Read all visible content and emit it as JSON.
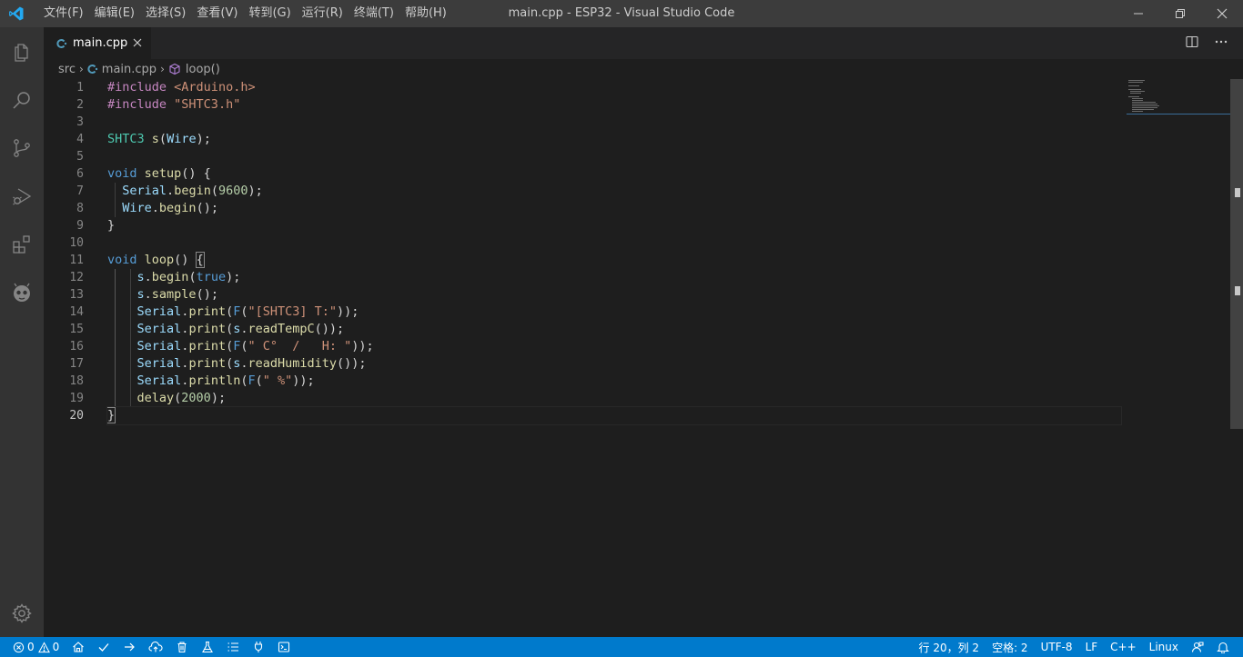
{
  "titlebar": {
    "menu": [
      "文件(F)",
      "编辑(E)",
      "选择(S)",
      "查看(V)",
      "转到(G)",
      "运行(R)",
      "终端(T)",
      "帮助(H)"
    ],
    "window_title": "main.cpp - ESP32 - Visual Studio Code"
  },
  "activitybar": {
    "icons": [
      "explorer-icon",
      "search-icon",
      "source-control-icon",
      "run-debug-icon",
      "extensions-icon",
      "platformio-icon",
      "settings-gear-icon"
    ]
  },
  "tab": {
    "label": "main.cpp"
  },
  "breadcrumb": {
    "folder": "src",
    "file": "main.cpp",
    "symbol": "loop()"
  },
  "editor": {
    "line_numbers": [
      "1",
      "2",
      "3",
      "4",
      "5",
      "6",
      "7",
      "8",
      "9",
      "10",
      "11",
      "12",
      "13",
      "14",
      "15",
      "16",
      "17",
      "18",
      "19",
      "20"
    ]
  },
  "statusbar": {
    "errors": "0",
    "warnings": "0",
    "position": "行 20，列 2",
    "spaces": "空格: 2",
    "encoding": "UTF-8",
    "eol": "LF",
    "language": "C++",
    "platform": "Linux"
  },
  "colors": {
    "titlebar": "#3c3c3c",
    "activitybar": "#333333",
    "editor_bg": "#1e1e1e",
    "statusbar": "#007acc",
    "keyword": "#569cd6",
    "string": "#ce9178",
    "type": "#4ec9b0",
    "function": "#dcdcaa"
  }
}
